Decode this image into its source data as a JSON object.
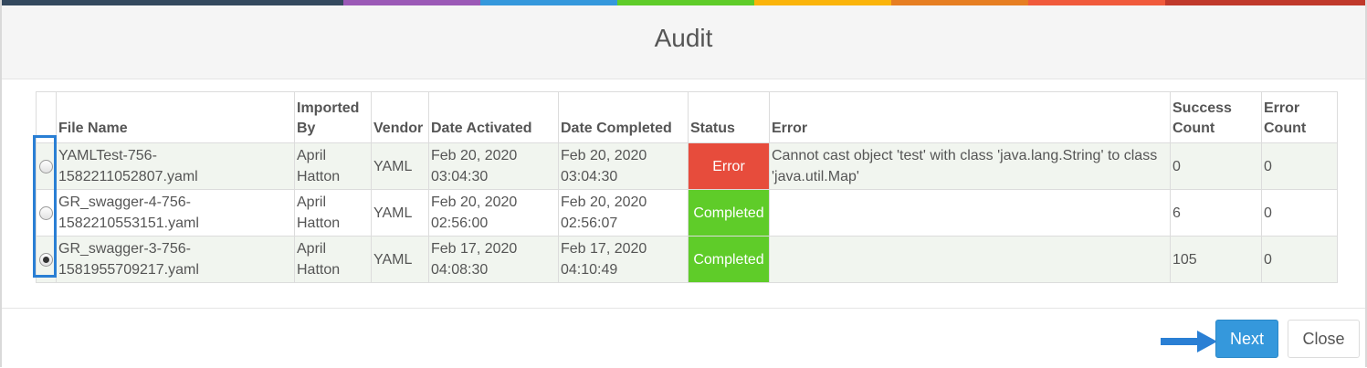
{
  "header_colors": [
    "#34495e",
    "#9b59b6",
    "#3598dc",
    "#5fcc29",
    "#fbb40a",
    "#e67e22",
    "#f05a3c",
    "#c0392b"
  ],
  "modal": {
    "title": "Audit"
  },
  "table": {
    "columns": [
      "",
      "File Name",
      "Imported By",
      "Vendor",
      "Date Activated",
      "Date Completed",
      "Status",
      "Error",
      "Success Count",
      "Error Count"
    ],
    "rows": [
      {
        "selected": false,
        "file_name": "YAMLTest-756-1582211052807.yaml",
        "imported_by": "April Hatton",
        "vendor": "YAML",
        "date_activated": "Feb 20, 2020 03:04:30",
        "date_completed": "Feb 20, 2020 03:04:30",
        "status": "Error",
        "error": "Cannot cast object 'test' with class 'java.lang.String' to class 'java.util.Map'",
        "success_count": "0",
        "error_count": "0"
      },
      {
        "selected": false,
        "file_name": "GR_swagger-4-756-1582210553151.yaml",
        "imported_by": "April Hatton",
        "vendor": "YAML",
        "date_activated": "Feb 20, 2020 02:56:00",
        "date_completed": "Feb 20, 2020 02:56:07",
        "status": "Completed",
        "error": "",
        "success_count": "6",
        "error_count": "0"
      },
      {
        "selected": true,
        "file_name": "GR_swagger-3-756-1581955709217.yaml",
        "imported_by": "April Hatton",
        "vendor": "YAML",
        "date_activated": "Feb 17, 2020 04:08:30",
        "date_completed": "Feb 17, 2020 04:10:49",
        "status": "Completed",
        "error": "",
        "success_count": "105",
        "error_count": "0"
      }
    ]
  },
  "status_colors": {
    "Error": "#e74c3c",
    "Completed": "#5fcc29"
  },
  "footer": {
    "next_label": "Next",
    "close_label": "Close"
  },
  "icons": {
    "pointer": "arrow-right-icon"
  }
}
